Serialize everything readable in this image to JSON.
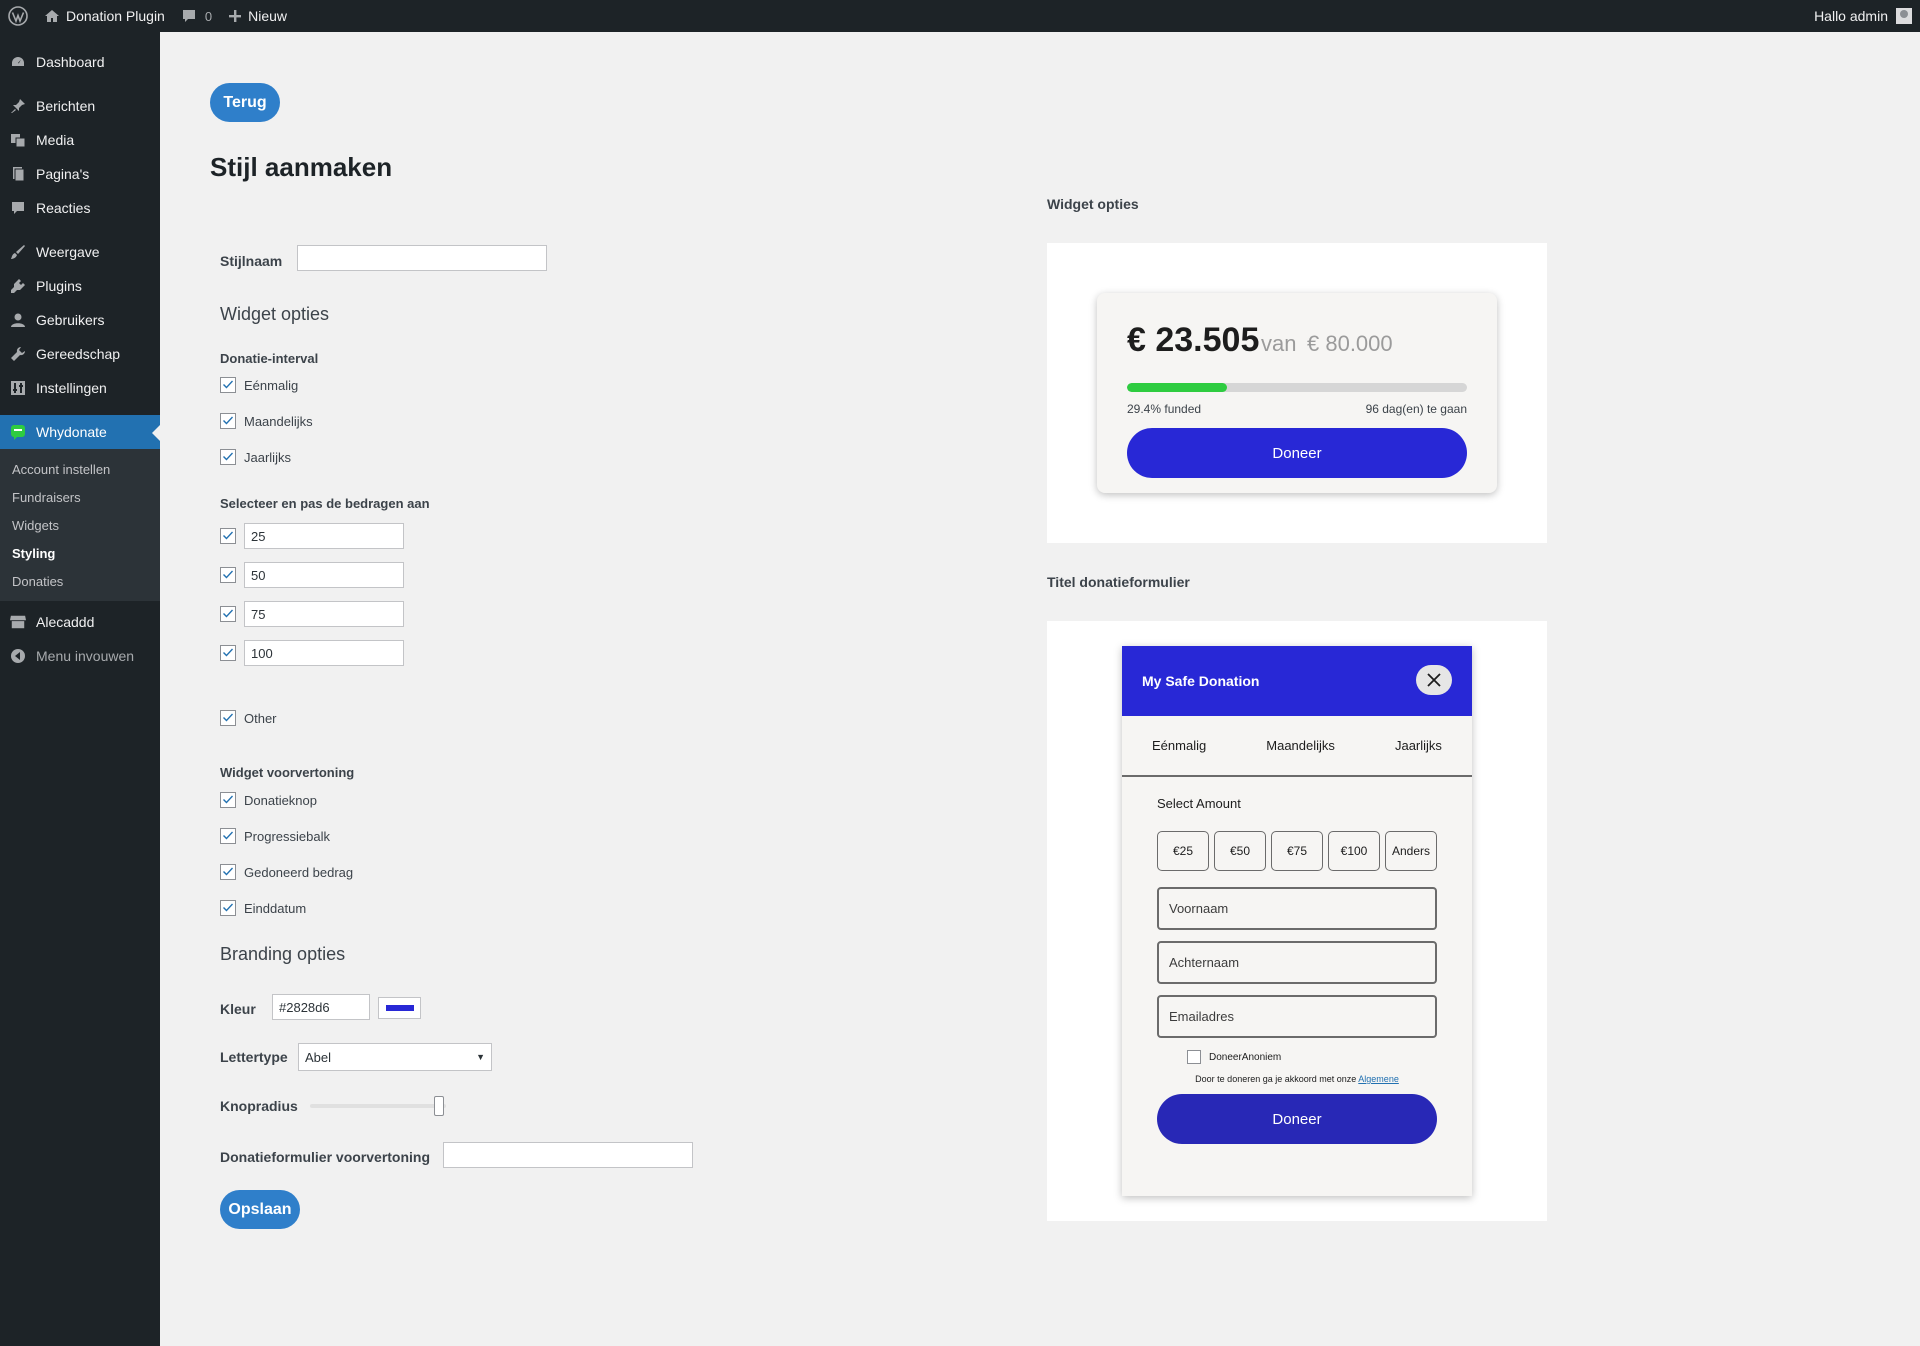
{
  "adminbar": {
    "site_name": "Donation Plugin",
    "comments_count": "0",
    "new_label": "Nieuw",
    "greeting": "Hallo admin"
  },
  "sidebar": {
    "items": [
      {
        "label": "Dashboard",
        "icon": "dashboard-icon"
      },
      {
        "label": "Berichten",
        "icon": "pin-icon"
      },
      {
        "label": "Media",
        "icon": "media-icon"
      },
      {
        "label": "Pagina's",
        "icon": "pages-icon"
      },
      {
        "label": "Reacties",
        "icon": "comments-icon"
      },
      {
        "label": "Weergave",
        "icon": "brush-icon"
      },
      {
        "label": "Plugins",
        "icon": "plugin-icon"
      },
      {
        "label": "Gebruikers",
        "icon": "users-icon"
      },
      {
        "label": "Gereedschap",
        "icon": "wrench-icon"
      },
      {
        "label": "Instellingen",
        "icon": "settings-icon"
      },
      {
        "label": "Whydonate",
        "icon": "whydonate-icon"
      },
      {
        "label": "Alecaddd",
        "icon": "store-icon"
      },
      {
        "label": "Menu invouwen",
        "icon": "collapse-icon"
      }
    ],
    "submenu": [
      "Account instellen",
      "Fundraisers",
      "Widgets",
      "Styling",
      "Donaties"
    ],
    "active_color": "#2271b1"
  },
  "main": {
    "back_label": "Terug",
    "title": "Stijl aanmaken",
    "style_name_label": "Stijlnaam",
    "style_name_value": "",
    "widget_options_title": "Widget opties",
    "interval_label": "Donatie-interval",
    "intervals": [
      "Eénmalig",
      "Maandelijks",
      "Jaarlijks"
    ],
    "amounts_label": "Selecteer en pas de bedragen aan",
    "amounts": [
      "25",
      "50",
      "75",
      "100"
    ],
    "other_label": "Other",
    "preview_label": "Widget voorvertoning",
    "preview_options": [
      "Donatieknop",
      "Progressiebalk",
      "Gedoneerd bedrag",
      "Einddatum"
    ],
    "branding_title": "Branding opties",
    "color_label": "Kleur",
    "color_value": "#2828d6",
    "font_label": "Lettertype",
    "font_value": "Abel",
    "radius_label": "Knopradius",
    "radius_value": 0.95,
    "form_preview_label": "Donatieformulier voorvertoning",
    "save_label": "Opslaan",
    "button_color": "#2f7fca"
  },
  "widget": {
    "panel_label": "Widget opties",
    "raised": "€ 23.505",
    "van": "van",
    "goal": "€ 80.000",
    "progress": 0.294,
    "funded_text": "29.4% funded",
    "days_text": "96 dag(en) te gaan",
    "donate_label": "Doneer",
    "progress_color": "#2ecc40",
    "button_color": "#2828d6"
  },
  "form": {
    "panel_label": "Titel donatieformulier",
    "title": "My Safe Donation",
    "tabs": [
      "Eénmalig",
      "Maandelijks",
      "Jaarlijks"
    ],
    "select_amount": "Select Amount",
    "amounts": [
      "€25",
      "€50",
      "€75",
      "€100",
      "Anders"
    ],
    "first_name": "Voornaam",
    "last_name": "Achternaam",
    "email": "Emailadres",
    "anon_label": "DoneerAnoniem",
    "terms_text": "Door te doneren ga je akkoord met onze",
    "terms_link": "Algemene",
    "donate_label": "Doneer",
    "header_color": "#2828d6",
    "button_color": "#2828b6"
  }
}
